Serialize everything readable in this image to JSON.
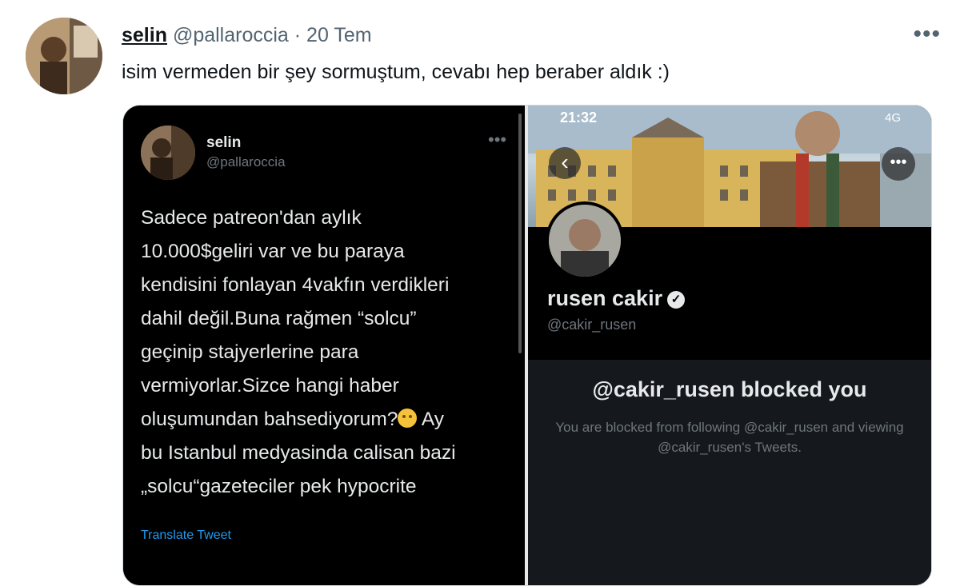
{
  "tweet": {
    "author_name": "selin",
    "author_handle": "@pallaroccia",
    "date": "· 20 Tem",
    "more_label": "•••",
    "text": "isim vermeden bir şey sormuştum, cevabı hep beraber aldık :)"
  },
  "left_screenshot": {
    "name": "selin",
    "handle": "@pallaroccia",
    "more_label": "•••",
    "lines": [
      "Sadece patreon'dan aylık",
      "10.000$geliri var ve bu paraya",
      "kendisini fonlayan 4vakfın verdikleri",
      "dahil değil.Buna rağmen “solcu”",
      "geçinip stajyerlerine para",
      "vermiyorlar.Sizce hangi haber",
      "oluşumundan bahsediyorum?",
      "bu Istanbul medyasinda calisan bazi",
      "„solcu“gazeteciler pek hypocrite"
    ],
    "line7_suffix": " Ay",
    "emoji": "smiling-face",
    "translate_label": "Translate Tweet"
  },
  "right_screenshot": {
    "status_time": "21:32",
    "status_network": "4G",
    "back_label": "‹",
    "more_label": "•••",
    "profile_name": "rusen cakir",
    "verified_label": "✓",
    "profile_handle": "@cakir_rusen",
    "blocked_title": "@cakir_rusen blocked you",
    "blocked_desc": "You are blocked from following @cakir_rusen and viewing @cakir_rusen's Tweets."
  }
}
